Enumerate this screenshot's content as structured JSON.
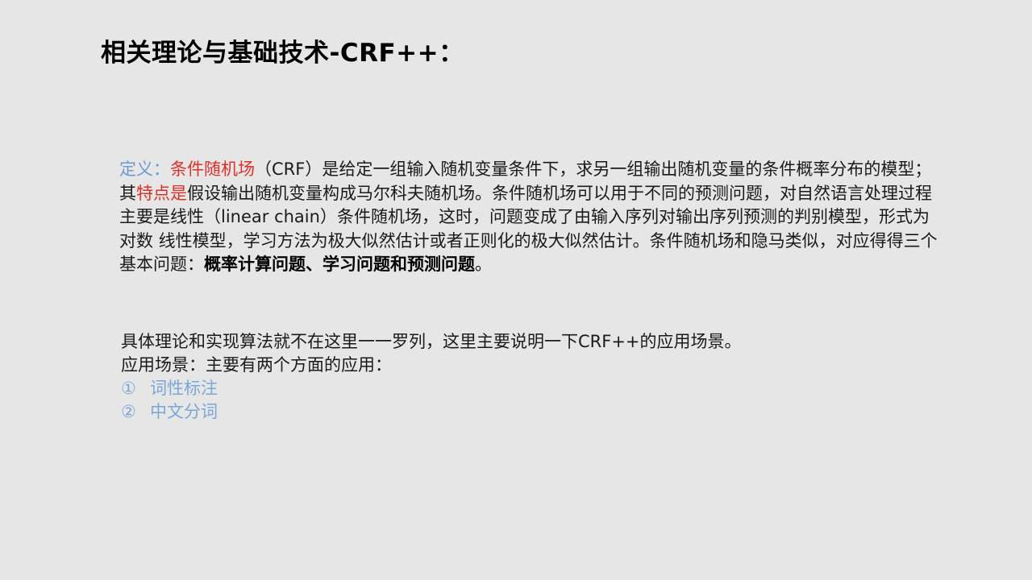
{
  "slide": {
    "title": "相关理论与基础技术-CRF++：",
    "definition": {
      "label": "定义：",
      "term": "条件随机场",
      "text1": "（CRF）是给定一组输入随机变量条件下，求另一组输出随机变量的条件概率分布的模型；其",
      "feature_label": "特点是",
      "text2": "假设输出随机变量构成马尔科夫随机场。条件随机场可以用于不同的预测问题，对自然语言处理过程主要是线性（linear chain）条件随机场，这时，问题变成了由输入序列对输出序列预测的判别模型，形式为对数 线性模型，学习方法为极大似然估计或者正则化的极大似然估计。条件随机场和隐马类似，对应得得三个基本问题：",
      "bold_text": "概率计算问题、学习问题和预测问题",
      "end": "。"
    },
    "intro_line": "具体理论和实现算法就不在这里一一罗列，这里主要说明一下CRF++的应用场景。",
    "apps_heading": "应用场景：主要有两个方面的应用：",
    "apps": [
      {
        "marker": "①",
        "label": "词性标注"
      },
      {
        "marker": "②",
        "label": "中文分词"
      }
    ],
    "colors": {
      "background": "#e6e6e6",
      "definition_label": "#6b9bd1",
      "highlight_red": "#e0302a",
      "list_blue": "#7aa7d6"
    }
  }
}
